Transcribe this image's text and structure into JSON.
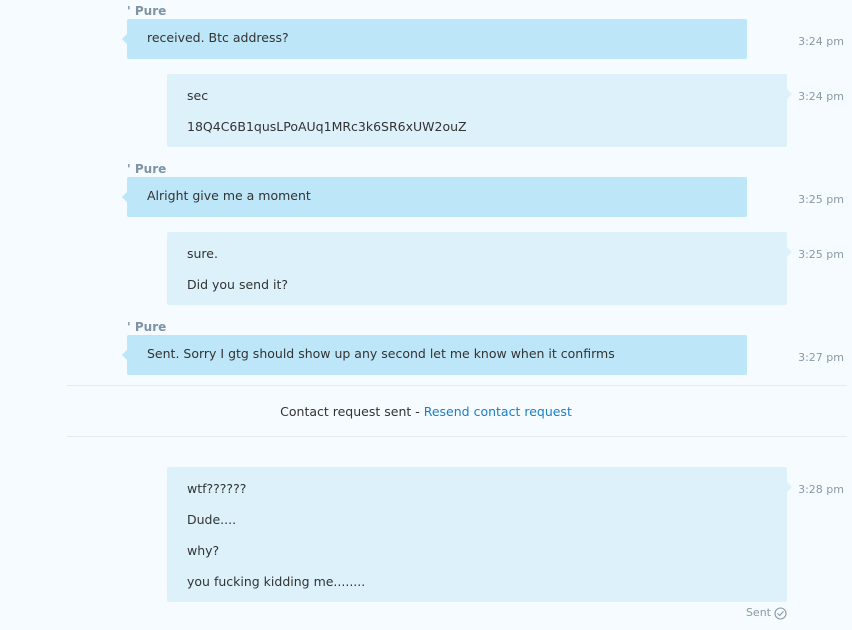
{
  "conversation": {
    "messages": [
      {
        "direction": "incoming",
        "sender": "' Pure",
        "lines": [
          "received. Btc address?"
        ],
        "time": "3:24 pm"
      },
      {
        "direction": "outgoing",
        "lines": [
          "sec",
          "18Q4C6B1qusLPoAUq1MRc3k6SR6xUW2ouZ"
        ],
        "time": "3:24 pm"
      },
      {
        "direction": "incoming",
        "sender": "' Pure",
        "lines": [
          "Alright give me a moment"
        ],
        "time": "3:25 pm"
      },
      {
        "direction": "outgoing",
        "lines": [
          "sure.",
          "Did you send it?"
        ],
        "time": "3:25 pm"
      },
      {
        "direction": "incoming",
        "sender": "' Pure",
        "lines": [
          "Sent. Sorry I gtg should show up any second let me know when it confirms"
        ],
        "time": "3:27 pm"
      },
      {
        "direction": "outgoing",
        "lines": [
          "wtf??????",
          "Dude....",
          "why?",
          "you fucking kidding me........"
        ],
        "time": "3:28 pm"
      }
    ],
    "notice": {
      "text": "Contact request sent - ",
      "link_label": "Resend contact request"
    },
    "status": {
      "label": "Sent",
      "icon": "check-circle-icon"
    }
  },
  "colors": {
    "background": "#f5fbfe",
    "incoming_bubble": "#bde6f8",
    "outgoing_bubble": "#dcf1fa",
    "link": "#1b7fc4",
    "meta_text": "#8a9aa5"
  }
}
